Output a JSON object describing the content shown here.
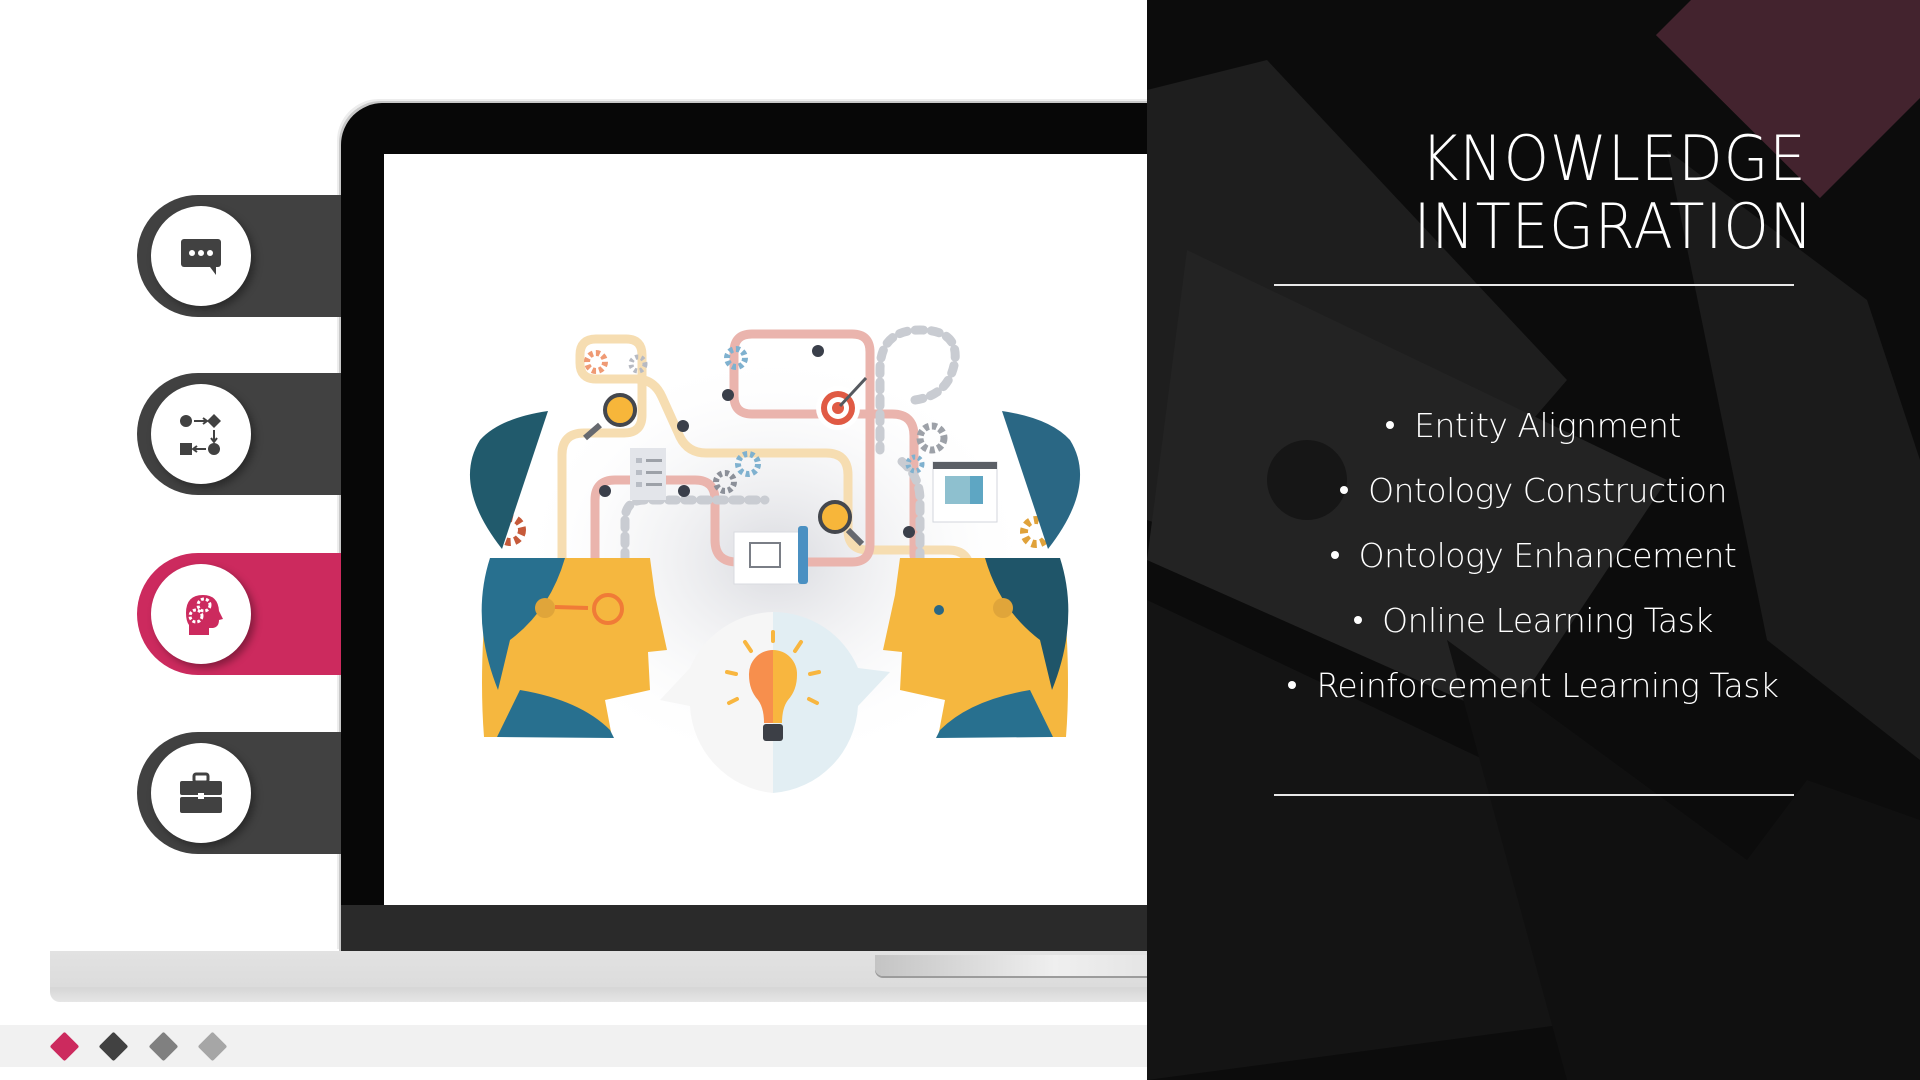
{
  "slide": {
    "title_lines": [
      "KNOWLEDGE",
      "INTEGRATION"
    ],
    "bullets": [
      "Entity Alignment",
      "Ontology Construction",
      "Ontology Enhancement",
      "Online Learning Task",
      "Reinforcement Learning Task"
    ]
  },
  "side_tabs": [
    {
      "icon": "chat-bubble-icon",
      "active": false
    },
    {
      "icon": "process-flow-icon",
      "active": false
    },
    {
      "icon": "head-gears-icon",
      "active": true
    },
    {
      "icon": "briefcase-icon",
      "active": false
    }
  ],
  "pager": {
    "count": 4,
    "current": 1,
    "colors": [
      "#cc2a5e",
      "#414141",
      "#808080",
      "#a6a6a6"
    ]
  },
  "colors": {
    "accent": "#cc2a5e",
    "tab_dark": "#414141",
    "panel_bg": "#0c0c0c",
    "overlay_diamond": "#43232e"
  },
  "illustration": {
    "subject": "two-heads-sharing-ideas-lightbulb"
  }
}
